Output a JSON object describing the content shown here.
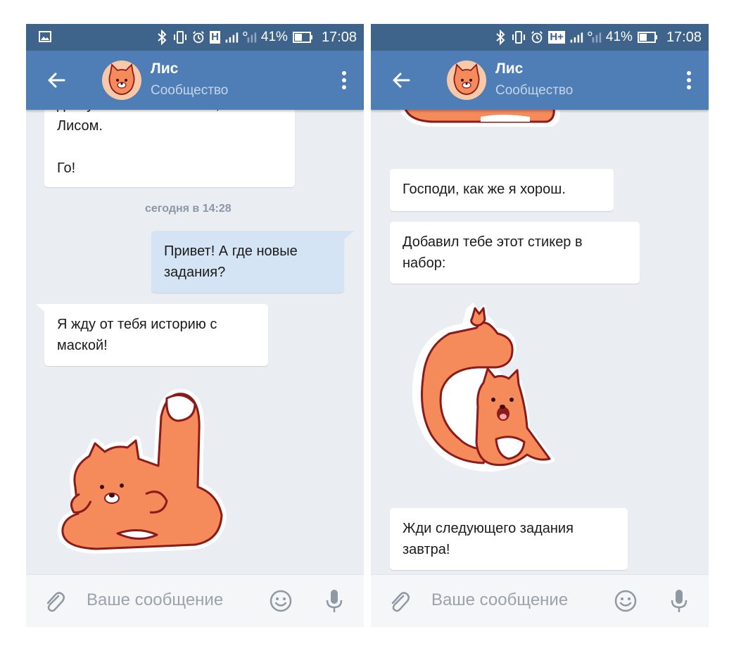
{
  "status_bar": {
    "battery_percent": "41%",
    "time": "17:08",
    "network_left": "H",
    "network_right": "H+"
  },
  "header": {
    "name": "Лис",
    "subtitle": "Сообщество"
  },
  "left_chat": {
    "partial_top_message": "доступна маска со мной,\nЛисом.\n\nГо!",
    "date_separator": "сегодня в 14:28",
    "outgoing_message": "Привет! А где новые\nзадания?",
    "incoming_message": "Я жду от тебя историю с\nмаской!"
  },
  "right_chat": {
    "message_1": "Господи, как же я хорош.",
    "message_2": "Добавил тебе этот стикер в\nнабор:",
    "message_3": "Жди следующего задания\nзавтра!"
  },
  "input": {
    "placeholder": "Ваше сообщение"
  },
  "colors": {
    "status_bar": "#3f648b",
    "app_bar": "#4f7db6",
    "chat_background": "#eaeef3",
    "outgoing_bubble": "#d5e4f4",
    "fox_orange": "#f58a5a",
    "fox_outline": "#8b1a1a"
  },
  "icons": {
    "back": "arrow-left-icon",
    "menu": "more-vertical-icon",
    "attach": "paperclip-icon",
    "emoji": "smile-icon",
    "mic": "microphone-icon"
  }
}
